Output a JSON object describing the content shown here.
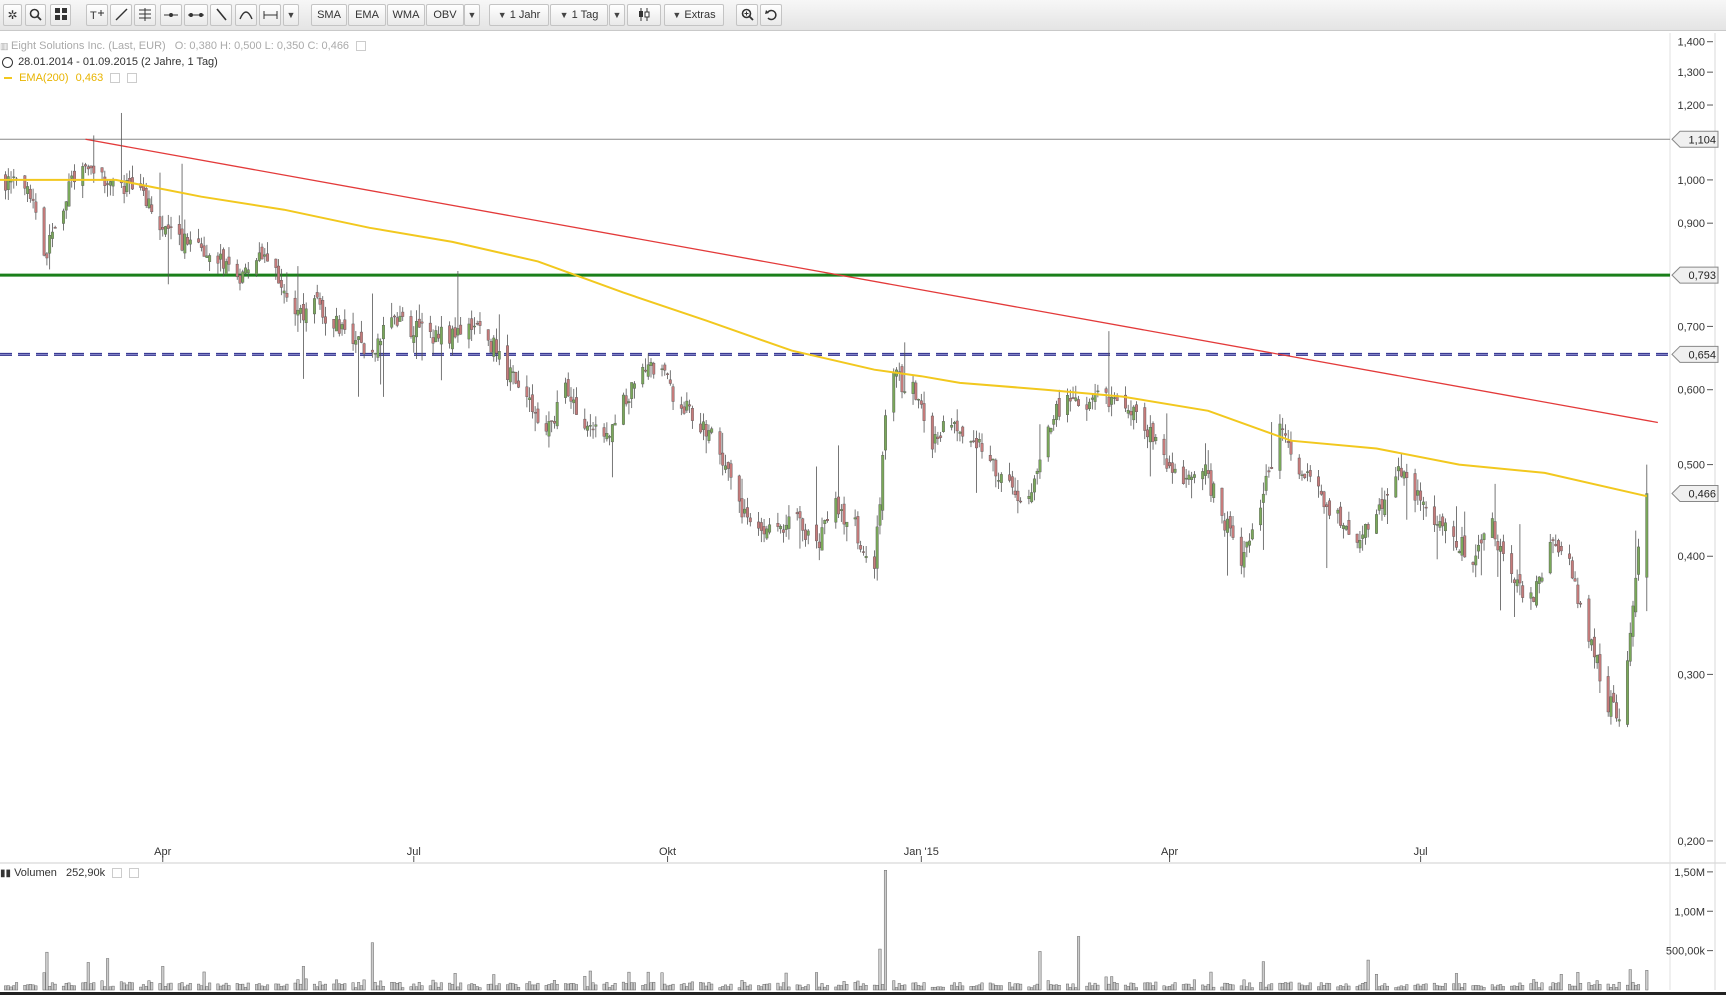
{
  "toolbar": {
    "buttons": [
      {
        "name": "settings-button",
        "icon": "gear-icon",
        "glyph": "✲"
      },
      {
        "name": "zoom-search-button",
        "icon": "search-icon"
      },
      {
        "name": "layout-grid-button",
        "icon": "grid-icon"
      },
      {
        "name": "text-tool-button",
        "icon": "text-add-icon"
      },
      {
        "name": "trendline-tool-button",
        "icon": "trendline-icon"
      },
      {
        "name": "fibonacci-tool-button",
        "icon": "fibonacci-icon"
      },
      {
        "name": "horizontal-line-tool-button",
        "icon": "horizontal-line-icon"
      },
      {
        "name": "channel-tool-button",
        "icon": "channel-icon"
      },
      {
        "name": "pencil-tool-button",
        "icon": "pencil-icon"
      },
      {
        "name": "arc-tool-button",
        "icon": "arc-icon"
      },
      {
        "name": "measure-tool-button",
        "icon": "measure-icon"
      }
    ],
    "indicators": [
      "SMA",
      "EMA",
      "WMA",
      "OBV"
    ],
    "range_label": "1 Jahr",
    "interval_label": "1 Tag",
    "extras_label": "Extras"
  },
  "legend": {
    "instrument": "Eight Solutions Inc. (Last, EUR)",
    "ohlc": "O: 0,380   H: 0,500   L: 0,350   C: 0,466",
    "period": "28.01.2014 - 01.09.2015 (2 Jahre, 1 Tag)",
    "ema_label": "EMA(200)",
    "ema_value": "0,463",
    "volume_label": "Volumen",
    "volume_value": "252,90k"
  },
  "colors": {
    "candle_up": "#7aa85a",
    "candle_down": "#c57b7b",
    "ema": "#f2c81e",
    "trendline": "#e33a3a",
    "support_line": "#1a7f1a",
    "dashed_line": "#2e2f8a",
    "resistance_line": "#888888",
    "volume_bar": "#cccccc"
  },
  "chart_data": {
    "type": "candlestick",
    "instrument": "Eight Solutions Inc.",
    "currency": "EUR",
    "scale": "log",
    "price_range": [
      0.19,
      1.43
    ],
    "y_ticks": [
      "1,400",
      "1,300",
      "1,200",
      "1,000",
      "0,900",
      "0,700",
      "0,600",
      "0,500",
      "0,400",
      "0,300",
      "0,200"
    ],
    "x_range": [
      "2014-02-01",
      "2015-10-15"
    ],
    "x_ticks": [
      {
        "label": "Apr",
        "date": "2014-04-01"
      },
      {
        "label": "Jul",
        "date": "2014-07-01"
      },
      {
        "label": "Okt",
        "date": "2014-10-01"
      },
      {
        "label": "Jan '15",
        "date": "2015-01-01"
      },
      {
        "label": "Apr",
        "date": "2015-04-01"
      },
      {
        "label": "Jul",
        "date": "2015-07-01"
      }
    ],
    "last_close": "0,466",
    "horizontal_lines": [
      {
        "label": "1,104",
        "value": 1.104,
        "style": "solid-thin",
        "color": "#888888"
      },
      {
        "label": "0,793",
        "value": 0.793,
        "style": "solid-thick",
        "color": "#1a7f1a"
      },
      {
        "label": "0,654",
        "value": 0.654,
        "style": "dashed",
        "color": "#2e2f8a"
      }
    ],
    "trendline": {
      "start": {
        "date": "2014-03-04",
        "price": 1.104
      },
      "end": {
        "date": "2015-09-25",
        "price": 0.554
      }
    },
    "series": [
      {
        "name": "price",
        "type": "close_path",
        "points": [
          [
            "2014-02-03",
            1.0
          ],
          [
            "2014-02-12",
            0.96
          ],
          [
            "2014-02-17",
            0.82
          ],
          [
            "2014-02-24",
            0.95
          ],
          [
            "2014-03-04",
            1.05
          ],
          [
            "2014-03-10",
            1.01
          ],
          [
            "2014-03-17",
            0.99
          ],
          [
            "2014-03-24",
            0.97
          ],
          [
            "2014-03-31",
            0.9
          ],
          [
            "2014-04-07",
            0.86
          ],
          [
            "2014-04-14",
            0.85
          ],
          [
            "2014-04-22",
            0.82
          ],
          [
            "2014-04-28",
            0.78
          ],
          [
            "2014-05-05",
            0.83
          ],
          [
            "2014-05-12",
            0.8
          ],
          [
            "2014-05-19",
            0.72
          ],
          [
            "2014-05-26",
            0.74
          ],
          [
            "2014-06-02",
            0.71
          ],
          [
            "2014-06-09",
            0.68
          ],
          [
            "2014-06-16",
            0.66
          ],
          [
            "2014-06-23",
            0.72
          ],
          [
            "2014-06-30",
            0.7
          ],
          [
            "2014-07-07",
            0.69
          ],
          [
            "2014-07-14",
            0.68
          ],
          [
            "2014-07-21",
            0.7
          ],
          [
            "2014-07-28",
            0.68
          ],
          [
            "2014-08-04",
            0.63
          ],
          [
            "2014-08-11",
            0.58
          ],
          [
            "2014-08-18",
            0.54
          ],
          [
            "2014-08-25",
            0.6
          ],
          [
            "2014-09-01",
            0.56
          ],
          [
            "2014-09-08",
            0.53
          ],
          [
            "2014-09-15",
            0.58
          ],
          [
            "2014-09-22",
            0.64
          ],
          [
            "2014-09-29",
            0.62
          ],
          [
            "2014-10-06",
            0.58
          ],
          [
            "2014-10-13",
            0.55
          ],
          [
            "2014-10-20",
            0.52
          ],
          [
            "2014-10-27",
            0.45
          ],
          [
            "2014-11-03",
            0.42
          ],
          [
            "2014-11-10",
            0.43
          ],
          [
            "2014-11-17",
            0.44
          ],
          [
            "2014-11-24",
            0.41
          ],
          [
            "2014-12-01",
            0.45
          ],
          [
            "2014-12-08",
            0.43
          ],
          [
            "2014-12-15",
            0.38
          ],
          [
            "2014-12-19",
            0.55
          ],
          [
            "2014-12-22",
            0.62
          ],
          [
            "2014-12-29",
            0.6
          ],
          [
            "2015-01-05",
            0.53
          ],
          [
            "2015-01-12",
            0.56
          ],
          [
            "2015-01-19",
            0.54
          ],
          [
            "2015-01-26",
            0.5
          ],
          [
            "2015-02-02",
            0.47
          ],
          [
            "2015-02-09",
            0.46
          ],
          [
            "2015-02-16",
            0.54
          ],
          [
            "2015-02-23",
            0.6
          ],
          [
            "2015-03-02",
            0.58
          ],
          [
            "2015-03-09",
            0.59
          ],
          [
            "2015-03-16",
            0.57
          ],
          [
            "2015-03-23",
            0.55
          ],
          [
            "2015-03-30",
            0.51
          ],
          [
            "2015-04-06",
            0.48
          ],
          [
            "2015-04-13",
            0.5
          ],
          [
            "2015-04-20",
            0.44
          ],
          [
            "2015-04-27",
            0.4
          ],
          [
            "2015-05-04",
            0.45
          ],
          [
            "2015-05-11",
            0.55
          ],
          [
            "2015-05-18",
            0.5
          ],
          [
            "2015-05-25",
            0.47
          ],
          [
            "2015-06-01",
            0.44
          ],
          [
            "2015-06-08",
            0.41
          ],
          [
            "2015-06-15",
            0.44
          ],
          [
            "2015-06-22",
            0.49
          ],
          [
            "2015-06-29",
            0.47
          ],
          [
            "2015-07-06",
            0.44
          ],
          [
            "2015-07-13",
            0.42
          ],
          [
            "2015-07-20",
            0.4
          ],
          [
            "2015-07-27",
            0.43
          ],
          [
            "2015-08-03",
            0.38
          ],
          [
            "2015-08-10",
            0.36
          ],
          [
            "2015-08-17",
            0.41
          ],
          [
            "2015-08-24",
            0.39
          ],
          [
            "2015-08-31",
            0.33
          ],
          [
            "2015-09-07",
            0.28
          ],
          [
            "2015-09-11",
            0.27
          ],
          [
            "2015-09-14",
            0.31
          ],
          [
            "2015-09-17",
            0.38
          ],
          [
            "2015-09-21",
            0.466
          ]
        ]
      },
      {
        "name": "EMA(200)",
        "type": "line",
        "points": [
          [
            "2014-02-01",
            1.0
          ],
          [
            "2014-03-15",
            1.0
          ],
          [
            "2014-04-15",
            0.96
          ],
          [
            "2014-05-15",
            0.93
          ],
          [
            "2014-06-15",
            0.89
          ],
          [
            "2014-07-15",
            0.86
          ],
          [
            "2014-08-15",
            0.82
          ],
          [
            "2014-09-15",
            0.76
          ],
          [
            "2014-10-15",
            0.71
          ],
          [
            "2014-11-15",
            0.66
          ],
          [
            "2014-12-15",
            0.63
          ],
          [
            "2015-01-01",
            0.62
          ],
          [
            "2015-01-15",
            0.61
          ],
          [
            "2015-02-15",
            0.6
          ],
          [
            "2015-03-15",
            0.59
          ],
          [
            "2015-04-15",
            0.57
          ],
          [
            "2015-05-15",
            0.53
          ],
          [
            "2015-06-15",
            0.52
          ],
          [
            "2015-07-15",
            0.5
          ],
          [
            "2015-08-15",
            0.49
          ],
          [
            "2015-09-21",
            0.463
          ]
        ]
      }
    ],
    "volume": {
      "ticks": [
        "1,50M",
        "1,00M",
        "500,00k"
      ],
      "range": [
        0,
        1.6
      ],
      "unit": "M",
      "spikes": [
        [
          "2014-02-18",
          0.48
        ],
        [
          "2014-03-05",
          0.35
        ],
        [
          "2014-03-12",
          0.4
        ],
        [
          "2014-04-01",
          0.3
        ],
        [
          "2014-05-22",
          0.3
        ],
        [
          "2014-06-16",
          0.6
        ],
        [
          "2014-12-17",
          0.52
        ],
        [
          "2014-12-19",
          1.52
        ],
        [
          "2015-02-13",
          0.49
        ],
        [
          "2015-02-27",
          0.68
        ],
        [
          "2015-05-05",
          0.36
        ],
        [
          "2015-06-12",
          0.38
        ],
        [
          "2015-09-21",
          0.25
        ]
      ]
    }
  }
}
